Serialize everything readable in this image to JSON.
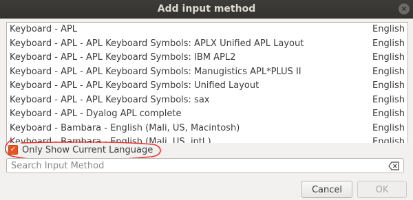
{
  "window": {
    "title": "Add input method",
    "close_icon": "close-icon",
    "close_glyph": "×"
  },
  "list": {
    "items": [
      {
        "name": "Keyboard - APL",
        "language": "English"
      },
      {
        "name": "Keyboard - APL - APL Keyboard Symbols: APLX Unified APL Layout",
        "language": "English"
      },
      {
        "name": "Keyboard - APL - APL Keyboard Symbols: IBM APL2",
        "language": "English"
      },
      {
        "name": "Keyboard - APL - APL Keyboard Symbols: Manugistics APL*PLUS II",
        "language": "English"
      },
      {
        "name": "Keyboard - APL - APL Keyboard Symbols: Unified Layout",
        "language": "English"
      },
      {
        "name": "Keyboard - APL - APL Keyboard Symbols: sax",
        "language": "English"
      },
      {
        "name": "Keyboard - APL - Dyalog APL complete",
        "language": "English"
      },
      {
        "name": "Keyboard - Bambara - English (Mali, US, Macintosh)",
        "language": "English"
      },
      {
        "name": "Keyboard - Bambara - English (Mali, US, intl.)",
        "language": "English"
      }
    ]
  },
  "filter": {
    "checkbox_label": "Only Show Current Language",
    "checked": true,
    "check_glyph": "✓"
  },
  "search": {
    "placeholder": "Search Input Method",
    "value": "",
    "clear_icon": "backspace-clear-icon"
  },
  "buttons": {
    "cancel": "Cancel",
    "ok": "OK"
  },
  "colors": {
    "titlebar": "#3d3c38",
    "accent": "#e95420",
    "annotation": "#e8312f"
  }
}
